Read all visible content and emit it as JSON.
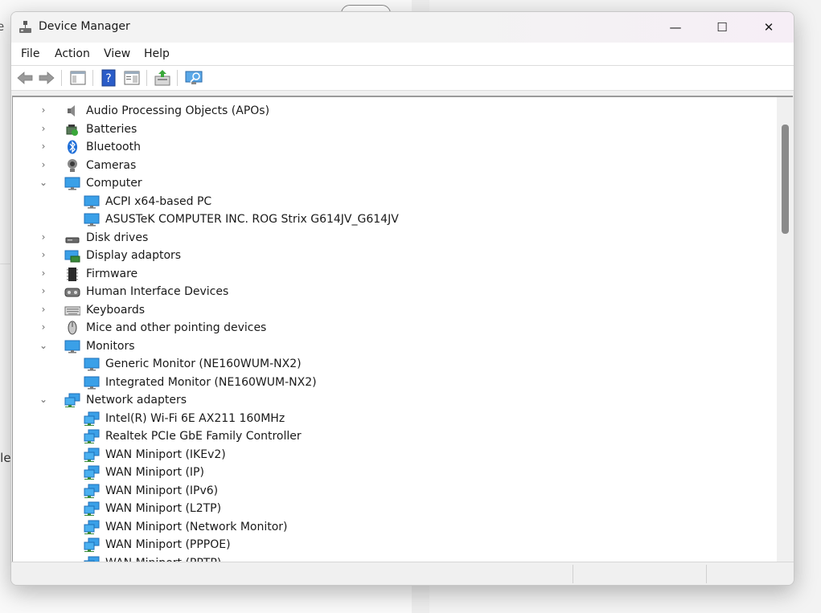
{
  "background": {
    "left_text_top": "e",
    "left_text_mid": "lle"
  },
  "window": {
    "title": "Device Manager",
    "minimize_glyph": "—",
    "maximize_glyph": "☐",
    "close_glyph": "✕"
  },
  "menu": [
    "File",
    "Action",
    "View",
    "Help"
  ],
  "toolbar": [
    "back-arrow",
    "forward-arrow",
    "show-hide-console-tree",
    "help",
    "properties",
    "update-driver",
    "scan-hardware-changes"
  ],
  "tree": [
    {
      "label": "Audio Processing Objects (APOs)",
      "level": 0,
      "expander": "collapsed",
      "icon": "speaker-icon"
    },
    {
      "label": "Batteries",
      "level": 0,
      "expander": "collapsed",
      "icon": "battery-icon"
    },
    {
      "label": "Bluetooth",
      "level": 0,
      "expander": "collapsed",
      "icon": "bluetooth-icon"
    },
    {
      "label": "Cameras",
      "level": 0,
      "expander": "collapsed",
      "icon": "camera-icon"
    },
    {
      "label": "Computer",
      "level": 0,
      "expander": "expanded",
      "icon": "monitor-icon"
    },
    {
      "label": "ACPI x64-based PC",
      "level": 1,
      "expander": "none",
      "icon": "monitor-icon"
    },
    {
      "label": "ASUSTeK COMPUTER INC. ROG Strix G614JV_G614JV",
      "level": 1,
      "expander": "none",
      "icon": "monitor-icon"
    },
    {
      "label": "Disk drives",
      "level": 0,
      "expander": "collapsed",
      "icon": "disk-drive-icon"
    },
    {
      "label": "Display adaptors",
      "level": 0,
      "expander": "collapsed",
      "icon": "display-adapter-icon"
    },
    {
      "label": "Firmware",
      "level": 0,
      "expander": "collapsed",
      "icon": "chip-icon"
    },
    {
      "label": "Human Interface Devices",
      "level": 0,
      "expander": "collapsed",
      "icon": "hid-icon"
    },
    {
      "label": "Keyboards",
      "level": 0,
      "expander": "collapsed",
      "icon": "keyboard-icon"
    },
    {
      "label": "Mice and other pointing devices",
      "level": 0,
      "expander": "collapsed",
      "icon": "mouse-icon"
    },
    {
      "label": "Monitors",
      "level": 0,
      "expander": "expanded",
      "icon": "monitor-icon"
    },
    {
      "label": "Generic Monitor (NE160WUM-NX2)",
      "level": 1,
      "expander": "none",
      "icon": "monitor-icon"
    },
    {
      "label": "Integrated Monitor (NE160WUM-NX2)",
      "level": 1,
      "expander": "none",
      "icon": "monitor-icon"
    },
    {
      "label": "Network adapters",
      "level": 0,
      "expander": "expanded",
      "icon": "network-adapter-icon"
    },
    {
      "label": "Intel(R) Wi-Fi 6E AX211 160MHz",
      "level": 1,
      "expander": "none",
      "icon": "network-adapter-icon"
    },
    {
      "label": "Realtek PCIe GbE Family Controller",
      "level": 1,
      "expander": "none",
      "icon": "network-adapter-icon"
    },
    {
      "label": "WAN Miniport (IKEv2)",
      "level": 1,
      "expander": "none",
      "icon": "network-adapter-icon"
    },
    {
      "label": "WAN Miniport (IP)",
      "level": 1,
      "expander": "none",
      "icon": "network-adapter-icon"
    },
    {
      "label": "WAN Miniport (IPv6)",
      "level": 1,
      "expander": "none",
      "icon": "network-adapter-icon"
    },
    {
      "label": "WAN Miniport (L2TP)",
      "level": 1,
      "expander": "none",
      "icon": "network-adapter-icon"
    },
    {
      "label": "WAN Miniport (Network Monitor)",
      "level": 1,
      "expander": "none",
      "icon": "network-adapter-icon"
    },
    {
      "label": "WAN Miniport (PPPOE)",
      "level": 1,
      "expander": "none",
      "icon": "network-adapter-icon"
    },
    {
      "label": "WAN Miniport (PPTP)",
      "level": 1,
      "expander": "none",
      "icon": "network-adapter-icon"
    }
  ]
}
